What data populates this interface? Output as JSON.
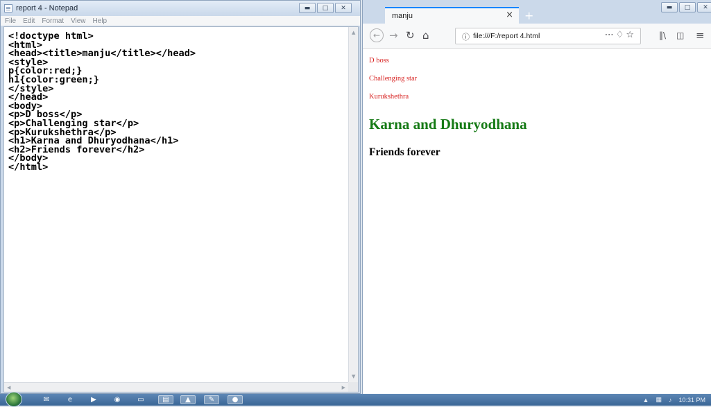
{
  "notepad": {
    "title": "report 4 - Notepad",
    "menu": [
      "File",
      "Edit",
      "Format",
      "View",
      "Help"
    ],
    "content": "<!doctype html>\n<html>\n<head><title>manju</title></head>\n<style>\np{color:red;}\nh1{color:green;}\n</style>\n</head>\n<body>\n<p>D boss</p>\n<p>Challenging star</p>\n<p>Kurukshethra</p>\n<h1>Karna and Dhuryodhana</h1>\n<h2>Friends forever</h2>\n</body>\n</html>"
  },
  "firefox": {
    "tab_title": "manju",
    "url": "file:///F:/report 4.html",
    "page": {
      "paragraphs": [
        "D boss",
        "Challenging star",
        "Kurukshethra"
      ],
      "h1": "Karna and Dhuryodhana",
      "h2": "Friends forever"
    }
  },
  "taskbar": {
    "clock": "10:31 PM"
  },
  "colors": {
    "paragraph": "#d7201f",
    "heading1": "#157a15",
    "active_tab_accent": "#0a84ff"
  },
  "icons": [
    "notepad-app-icon",
    "minimize-icon",
    "maximize-icon",
    "close-icon",
    "back-arrow-icon",
    "forward-arrow-icon",
    "reload-icon",
    "home-icon",
    "info-icon",
    "page-actions-icon",
    "pocket-icon",
    "bookmark-star-icon",
    "library-icon",
    "sidebar-icon",
    "menu-icon",
    "windows-start-icon"
  ]
}
